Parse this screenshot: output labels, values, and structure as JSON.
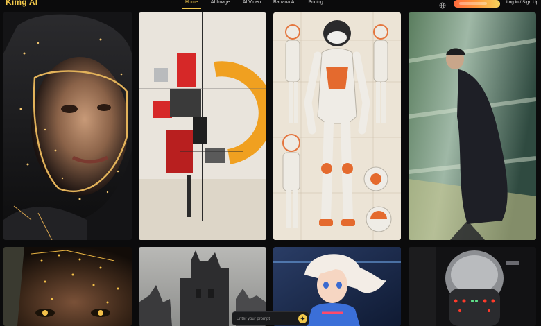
{
  "brand": {
    "name": "Kimg AI",
    "accent": "#f2c84b"
  },
  "nav": {
    "items": [
      {
        "label": "Home",
        "active": true
      },
      {
        "label": "AI Image",
        "active": false
      },
      {
        "label": "AI Video",
        "active": false
      },
      {
        "label": "Banana AI",
        "active": false
      },
      {
        "label": "Pricing",
        "active": false
      }
    ]
  },
  "header": {
    "login_label": "Log in / Sign Up",
    "globe_icon": "globe-icon"
  },
  "gallery": {
    "items": [
      {
        "name": "gallery-image-cyber-helmet-woman"
      },
      {
        "name": "gallery-image-abstract-red-orange-art"
      },
      {
        "name": "gallery-image-robot-suit-blueprint"
      },
      {
        "name": "gallery-image-motion-blur-man"
      },
      {
        "name": "gallery-image-glowing-face-closeup"
      },
      {
        "name": "gallery-image-gothic-tower"
      },
      {
        "name": "gallery-image-anime-girl"
      },
      {
        "name": "gallery-image-robot-head-lights"
      }
    ]
  },
  "prompt": {
    "placeholder": "Enter your prompt",
    "value": ""
  }
}
